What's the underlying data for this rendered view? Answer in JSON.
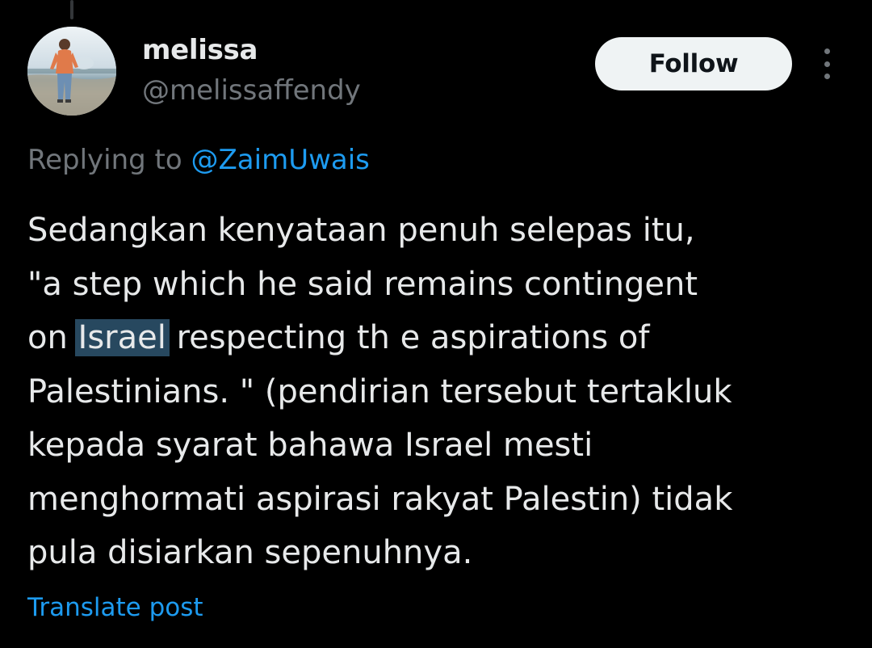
{
  "colors": {
    "background": "#000000",
    "text_primary": "#e7e9ea",
    "text_secondary": "#71767b",
    "accent_link": "#1d9bf0",
    "follow_button_bg": "#eff3f4",
    "follow_button_text": "#0f1419",
    "selection_highlight": "#27485f"
  },
  "author": {
    "display_name": "melissa",
    "handle": "@melissaffendy",
    "avatar_icon": "profile-photo"
  },
  "actions": {
    "follow_label": "Follow",
    "more_icon": "vertical-ellipsis-icon"
  },
  "reply_context": {
    "prefix": "Replying to ",
    "mention": "@ZaimUwais"
  },
  "tweet": {
    "line1": "Sedangkan kenyataan penuh selepas itu,",
    "line2": "\"a step which he said remains contingent",
    "line3_before": "on ",
    "line3_highlight": "Israel",
    "line3_after": " respecting th e aspirations of",
    "line4": "Palestinians. \" (pendirian tersebut tertakluk",
    "line5": "kepada syarat bahawa Israel mesti",
    "line6": "menghormati aspirasi rakyat Palestin) tidak",
    "line7": "pula disiarkan sepenuhnya."
  },
  "translate_label": "Translate post"
}
